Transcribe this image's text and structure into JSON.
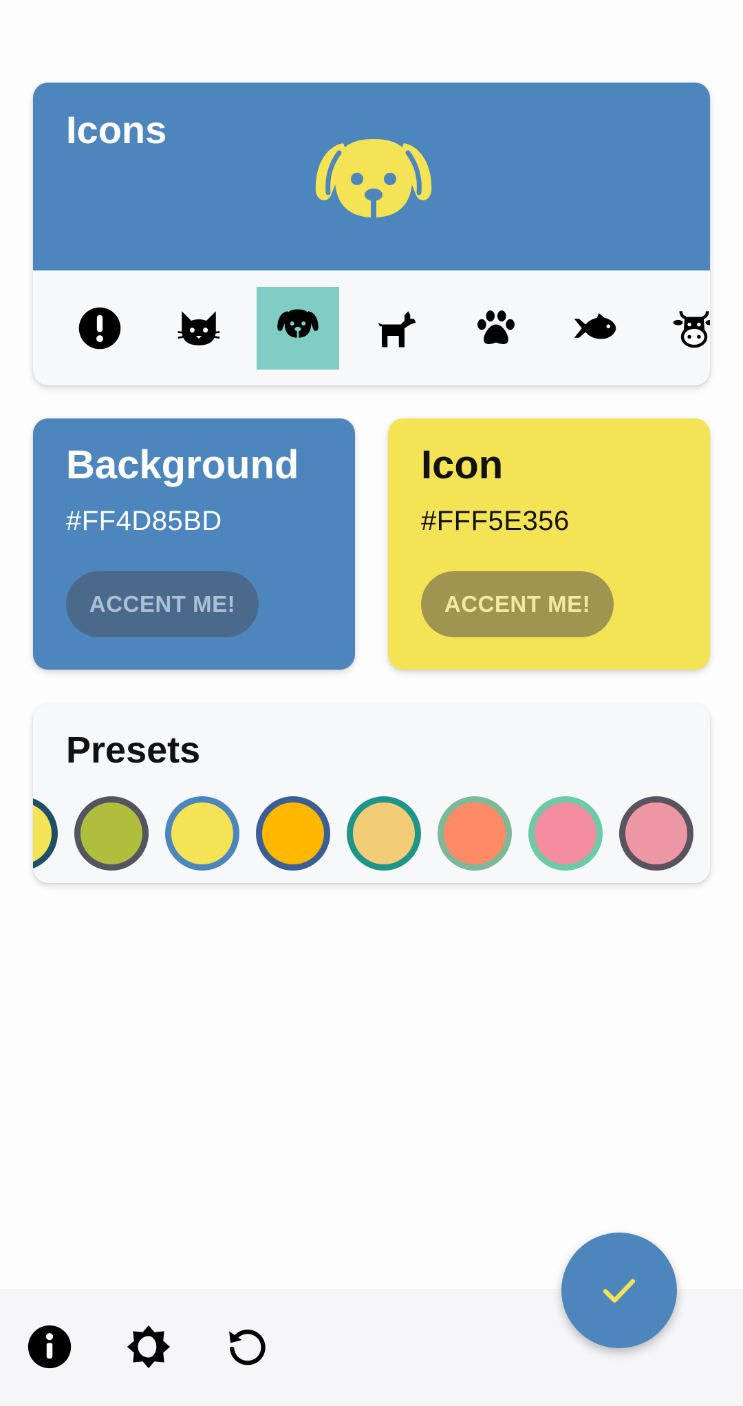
{
  "icons_card": {
    "title": "Icons",
    "preview_icon": "dog-face-icon",
    "strip": [
      {
        "icon": "alert-circle-icon",
        "selected": false
      },
      {
        "icon": "cat-icon",
        "selected": false
      },
      {
        "icon": "dog-face-icon",
        "selected": true
      },
      {
        "icon": "dog-side-icon",
        "selected": false
      },
      {
        "icon": "paw-icon",
        "selected": false
      },
      {
        "icon": "fish-icon",
        "selected": false
      },
      {
        "icon": "cow-icon",
        "selected": false
      }
    ]
  },
  "background_card": {
    "title": "Background",
    "hex": "#FF4D85BD",
    "button_label": "ACCENT ME!"
  },
  "icon_card": {
    "title": "Icon",
    "hex": "#FFF5E356",
    "button_label": "ACCENT ME!"
  },
  "presets_card": {
    "title": "Presets",
    "presets": [
      {
        "fill": "#f5e356",
        "border": "#1f4f66"
      },
      {
        "fill": "#afbf3d",
        "border": "#555461"
      },
      {
        "fill": "#f5e356",
        "border": "#4d85bd"
      },
      {
        "fill": "#ffb700",
        "border": "#3b5f95"
      },
      {
        "fill": "#f2cc76",
        "border": "#1f9488"
      },
      {
        "fill": "#ff8a65",
        "border": "#7fb897"
      },
      {
        "fill": "#f48ca0",
        "border": "#6ccaa6"
      },
      {
        "fill": "#ee97a4",
        "border": "#58535e"
      },
      {
        "fill": "#8fdbe6",
        "border": "#1e9cb5"
      }
    ]
  },
  "bottom_bar": {
    "items": [
      "info-icon",
      "brightness-icon",
      "reset-icon"
    ]
  },
  "fab": {
    "icon": "check-icon"
  },
  "colors": {
    "background": "#4d85bd",
    "icon": "#f5e356",
    "selected_highlight": "#80cdc4"
  }
}
